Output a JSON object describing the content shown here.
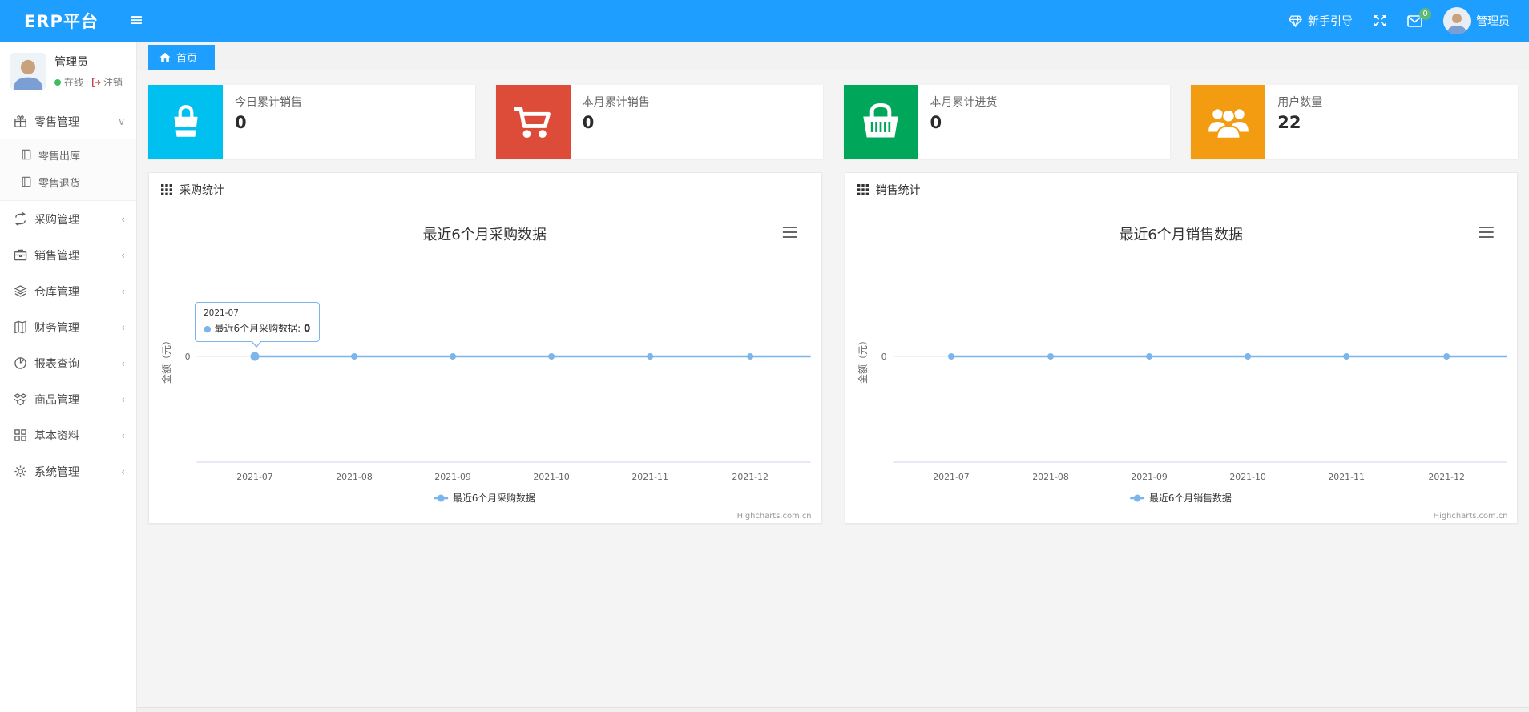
{
  "navbar": {
    "brand": "ERP平台",
    "guide_label": "新手引导",
    "message_badge": "0",
    "username": "管理员",
    "accent_color": "#1E9FFF",
    "badge_color": "#5FB878",
    "icons": [
      "menu-icon",
      "gem-icon",
      "fullscreen-icon",
      "mail-icon",
      "avatar"
    ]
  },
  "sidebar": {
    "user": {
      "name": "管理员",
      "status": "在线",
      "logout": "注销"
    },
    "menu": [
      {
        "label": "零售管理",
        "icon": "gift-icon",
        "state": "expanded",
        "children": [
          {
            "label": "零售出库",
            "icon": "file-icon"
          },
          {
            "label": "零售退货",
            "icon": "file-icon"
          }
        ]
      },
      {
        "label": "采购管理",
        "icon": "refresh-icon",
        "state": "collapsed"
      },
      {
        "label": "销售管理",
        "icon": "briefcase-icon",
        "state": "collapsed"
      },
      {
        "label": "仓库管理",
        "icon": "layers-icon",
        "state": "collapsed"
      },
      {
        "label": "财务管理",
        "icon": "book-icon",
        "state": "collapsed"
      },
      {
        "label": "报表查询",
        "icon": "pie-chart-icon",
        "state": "collapsed"
      },
      {
        "label": "商品管理",
        "icon": "box-icon",
        "state": "collapsed"
      },
      {
        "label": "基本资料",
        "icon": "grid-icon",
        "state": "collapsed"
      },
      {
        "label": "系统管理",
        "icon": "gear-icon",
        "state": "collapsed"
      }
    ],
    "chevron_expanded": "∨",
    "chevron_collapsed": "‹"
  },
  "tabs": {
    "home_label": "首页"
  },
  "stat_cards": [
    {
      "label": "今日累计销售",
      "value": "0",
      "color": "#00c0ef",
      "icon": "shopping-bag-icon"
    },
    {
      "label": "本月累计销售",
      "value": "0",
      "color": "#dd4b39",
      "icon": "cart-icon"
    },
    {
      "label": "本月累计进货",
      "value": "0",
      "color": "#00a65a",
      "icon": "basket-icon"
    },
    {
      "label": "用户数量",
      "value": "22",
      "color": "#f39c12",
      "icon": "users-icon"
    }
  ],
  "chart_data": [
    {
      "type": "line",
      "panel_title": "采购统计",
      "title": "最近6个月采购数据",
      "categories": [
        "2021-07",
        "2021-08",
        "2021-09",
        "2021-10",
        "2021-11",
        "2021-12"
      ],
      "series": [
        {
          "name": "最近6个月采购数据",
          "values": [
            0,
            0,
            0,
            0,
            0,
            0
          ],
          "color": "#7cb5ec"
        }
      ],
      "xlabel": "",
      "ylabel": "金额（元）",
      "yticks": [
        "0"
      ],
      "ylim": [
        0,
        0
      ],
      "grid": true,
      "legend_position": "bottom-center",
      "credits": "Highcharts.com.cn",
      "tooltip": {
        "header": "2021-07",
        "series": "最近6个月采购数据:",
        "value": "0"
      }
    },
    {
      "type": "line",
      "panel_title": "销售统计",
      "title": "最近6个月销售数据",
      "categories": [
        "2021-07",
        "2021-08",
        "2021-09",
        "2021-10",
        "2021-11",
        "2021-12"
      ],
      "series": [
        {
          "name": "最近6个月销售数据",
          "values": [
            0,
            0,
            0,
            0,
            0,
            0
          ],
          "color": "#7cb5ec"
        }
      ],
      "xlabel": "",
      "ylabel": "金额（元）",
      "yticks": [
        "0"
      ],
      "ylim": [
        0,
        0
      ],
      "grid": true,
      "legend_position": "bottom-center",
      "credits": "Highcharts.com.cn"
    }
  ]
}
